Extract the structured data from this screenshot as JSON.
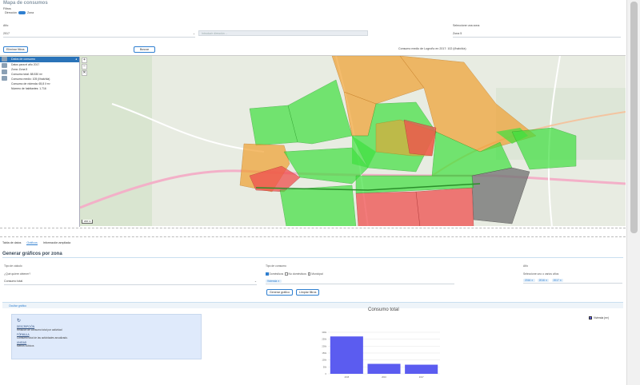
{
  "page": {
    "title": "Mapa de consumos"
  },
  "filters": {
    "label": "Filtros",
    "toggle_left": "Dirección",
    "toggle_right": "Zona",
    "year_label": "Año",
    "year_value": "2017",
    "search_placeholder": "Introducir dirección ...",
    "zone_label": "Seleccione una zona",
    "zone_value": "Zona 5",
    "clear_button": "Eliminar filtros",
    "search_button": "Buscar",
    "summary": "Consumo medio de Logroño en 2017: 102 (l/hab/día)"
  },
  "map": {
    "layer_title": "Datos de consumo",
    "layers": [
      "Datos para el año 2017",
      "Zona: Zona 5",
      "Consumo total: 88.530 m³",
      "Consumo medio: 105 (l/hab/día)",
      "Consumo de vivienda: 65,8 l/ m³",
      "Número de habitantes: 1.716"
    ],
    "zoom_in": "+",
    "zoom_out": "–",
    "close": "✕",
    "scale_label": "200 m",
    "colors": {
      "green": "#3fe03f",
      "orange": "#f0a030",
      "red": "#ef4f4f",
      "gray": "#777777"
    }
  },
  "tabs": [
    {
      "label": "Tabla de datos"
    },
    {
      "label": "Gráficos"
    },
    {
      "label": "Información ampliada"
    }
  ],
  "graphs": {
    "section_title": "Generar gráficos por zona",
    "calc_label": "Tipo de cálculo",
    "question_label": "¿Qué quiere obtener?",
    "calc_value": "Consumo total",
    "consumption_label": "Tipo de consumo",
    "opt_domestic": "Domésticos",
    "opt_non_domestic": "No domésticos",
    "opt_municipal": "Municipal",
    "selected_chip": "Vivienda ✕",
    "generate_button": "Generar gráfico",
    "clear_button": "Limpiar filtros",
    "year_label": "Año",
    "year_hint": "Seleccione uno o varios años",
    "years": [
      "2016 ✕",
      "2016 ✕",
      "2017 ✕"
    ]
  },
  "accordion": {
    "label": "Ocultar gráfico",
    "desc_h": "DESCRIPCIÓN",
    "desc_t": "Relación de consumo total por actividad",
    "form_h": "FÓRMULA",
    "form_t": "Consumo total de las actividades anualizado.",
    "unit_h": "UNIDAD",
    "unit_t": "Metros cúbicos"
  },
  "chart_data": {
    "type": "bar",
    "title": "Consumo total",
    "categories": [
      "2015",
      "2016",
      "2017"
    ],
    "series": [
      {
        "name": "Vivienda (m³)",
        "values": [
          270000,
          72000,
          66000
        ]
      }
    ],
    "y_ticks": [
      "300k",
      "250k",
      "200k",
      "150k",
      "100k",
      "50k",
      "0"
    ],
    "ylim": [
      0,
      300000
    ],
    "color": "#5b5cf0",
    "legend": "top-right"
  }
}
